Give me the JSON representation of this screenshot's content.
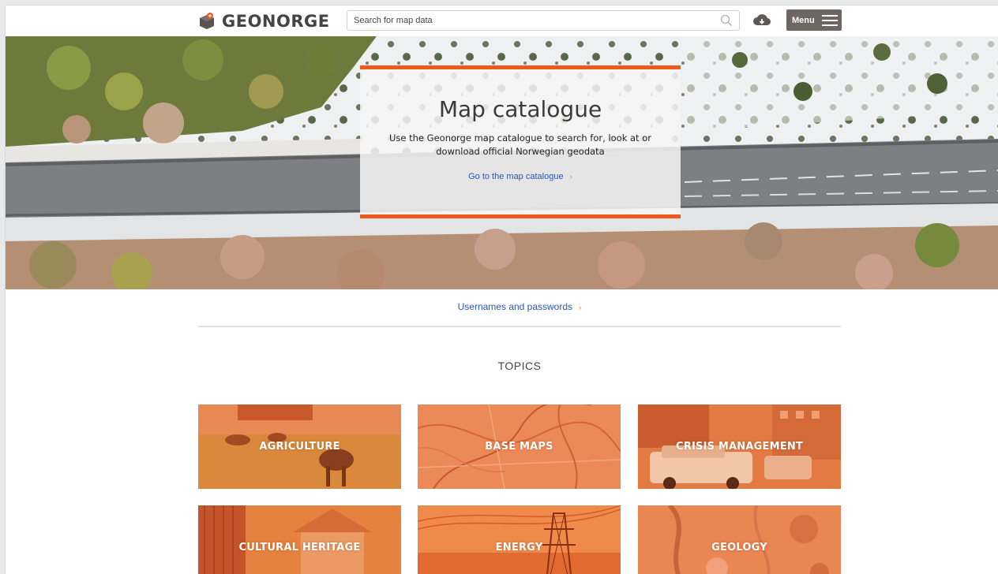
{
  "header": {
    "brand": "GEONORGE",
    "search_placeholder": "Search for map data",
    "search_value": "",
    "download_icon": "cloud-download-icon",
    "menu_label": "Menu"
  },
  "hero": {
    "title": "Map catalogue",
    "description": "Use the Geonorge map catalogue to search for, look at or download official Norwegian geodata",
    "link_label": "Go to the map catalogue",
    "link_chevron": "›"
  },
  "credentials": {
    "link_label": "Usernames and passwords",
    "chevron": "›"
  },
  "topics": {
    "title": "TOPICS",
    "items": [
      {
        "label": "AGRICULTURE"
      },
      {
        "label": "BASE MAPS"
      },
      {
        "label": "CRISIS MANAGEMENT"
      },
      {
        "label": "CULTURAL HERITAGE"
      },
      {
        "label": "ENERGY"
      },
      {
        "label": "GEOLOGY"
      }
    ]
  },
  "colors": {
    "accent": "#ee5a1c",
    "link": "#2b56b8",
    "menu_bg": "#6e6662",
    "tile_orange": "#e8763f"
  }
}
